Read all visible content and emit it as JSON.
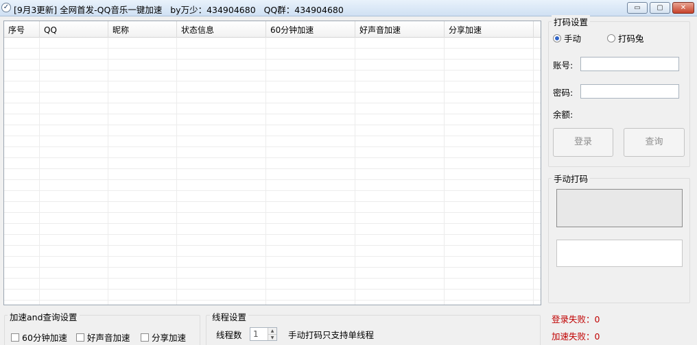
{
  "window": {
    "title": "[9月3更新] 全网首发-QQ音乐一键加速   by万少：434904680   QQ群：434904680",
    "app_icon": "check-circle-icon",
    "controls": {
      "minimize": "▭",
      "maximize": "▢",
      "close": "✕"
    }
  },
  "list": {
    "columns": [
      "序号",
      "QQ",
      "昵称",
      "状态信息",
      "60分钟加速",
      "好声音加速",
      "分享加速"
    ],
    "rows": []
  },
  "captcha_settings": {
    "title": "打码设置",
    "mode_manual": "手动",
    "mode_auto": "打码兔",
    "selected": "手动",
    "account_label": "账号:",
    "account_value": "",
    "password_label": "密码:",
    "password_value": "",
    "balance_label": "余额:",
    "login_button": "登录",
    "query_button": "查询"
  },
  "manual_captcha": {
    "title": "手动打码",
    "input_value": ""
  },
  "status": {
    "login_fail": "登录失败：0",
    "speed_fail": "加速失败：0",
    "color": "#c00000"
  },
  "speed_settings": {
    "title": "加速and查询设置",
    "options": [
      "60分钟加速",
      "好声音加速",
      "分享加速"
    ],
    "checked": [
      false,
      false,
      false
    ]
  },
  "thread_settings": {
    "title": "线程设置",
    "count_label": "线程数",
    "count_value": "1",
    "note": "手动打码只支持单线程"
  }
}
